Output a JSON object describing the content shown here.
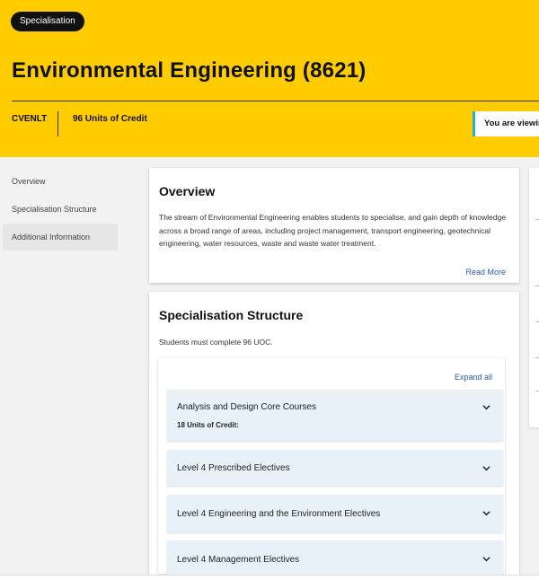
{
  "hero": {
    "badge": "Specialisation",
    "title": "Environmental Engineering (8621)",
    "code": "CVENLT",
    "units": "96 Units of Credit",
    "viewing_text": "You are viewing",
    "accent_color": "#ffcc00"
  },
  "sidenav": {
    "items": [
      {
        "label": "Overview"
      },
      {
        "label": "Specialisation Structure"
      },
      {
        "label": "Additional Information"
      }
    ]
  },
  "overview": {
    "heading": "Overview",
    "body": "The stream of Environmental Engineering enables students to specialise, and gain depth of knowledge across a broad range of areas, including project management, transport engineering, geotechnical engineering, water resources, waste and waste water treatment.",
    "read_more": "Read More"
  },
  "structure": {
    "heading": "Specialisation Structure",
    "subtitle": "Students must complete 96 UOC.",
    "expand_all": "Expand all",
    "groups": [
      {
        "title": "Analysis and Design Core Courses",
        "units": "18 Units of Credit:"
      },
      {
        "title": "Level 4 Prescribed Electives"
      },
      {
        "title": "Level 4 Engineering and the Environment Electives"
      },
      {
        "title": "Level 4 Management Electives"
      }
    ]
  }
}
